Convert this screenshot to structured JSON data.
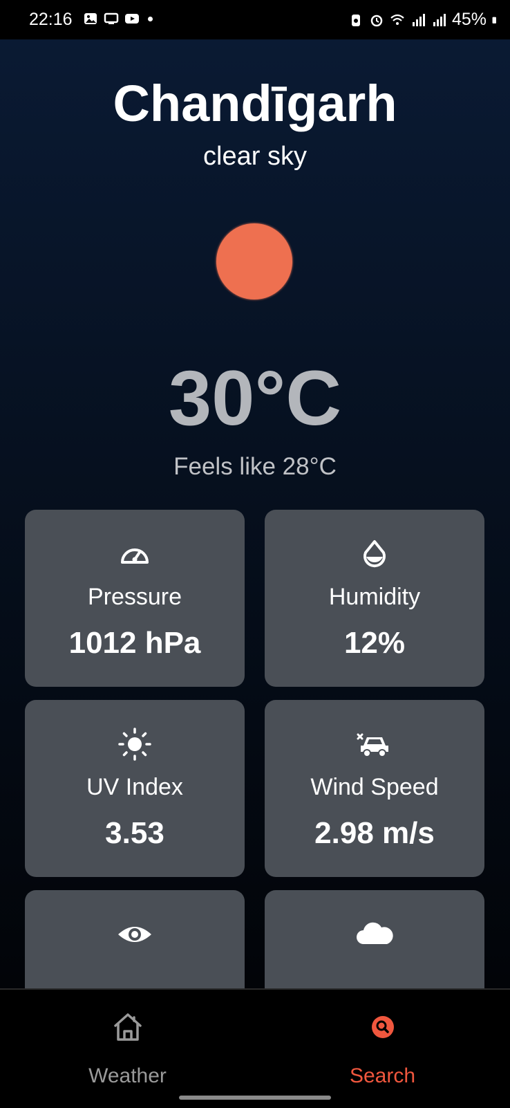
{
  "status_bar": {
    "time": "22:16",
    "battery": "45%",
    "left_icons": [
      "gallery-icon",
      "cast-icon",
      "youtube-icon",
      "notification-dot"
    ],
    "right_icons": [
      "battery-saver-icon",
      "alarm-icon",
      "wifi-icon",
      "signal-icon",
      "signal-icon"
    ]
  },
  "weather": {
    "city": "Chandīgarh",
    "description": "clear sky",
    "temperature": "30°C",
    "feels_like": "Feels like 28°C",
    "sun_color": "#ee7050"
  },
  "cards": [
    {
      "icon": "speedometer-icon",
      "label": "Pressure",
      "value": "1012 hPa"
    },
    {
      "icon": "water-drop-icon",
      "label": "Humidity",
      "value": "12%"
    },
    {
      "icon": "sun-icon",
      "label": "UV Index",
      "value": "3.53"
    },
    {
      "icon": "car-wind-icon",
      "label": "Wind Speed",
      "value": "2.98 m/s"
    },
    {
      "icon": "eye-icon",
      "label": "",
      "value": ""
    },
    {
      "icon": "cloud-icon",
      "label": "",
      "value": ""
    }
  ],
  "nav": {
    "items": [
      {
        "label": "Weather",
        "icon": "home-icon",
        "active": false
      },
      {
        "label": "Search",
        "icon": "search-icon",
        "active": true
      }
    ],
    "active_color": "#f0573e",
    "inactive_color": "#9a9a9a"
  }
}
